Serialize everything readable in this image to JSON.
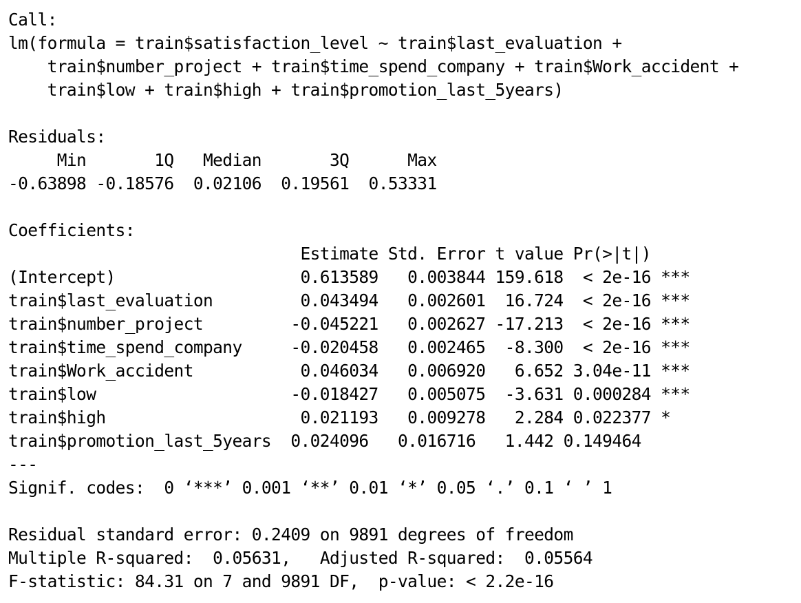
{
  "lines": [
    "Call:",
    "lm(formula = train$satisfaction_level ~ train$last_evaluation +",
    "    train$number_project + train$time_spend_company + train$Work_accident +",
    "    train$low + train$high + train$promotion_last_5years)",
    "",
    "Residuals:",
    "     Min       1Q   Median       3Q      Max",
    "-0.63898 -0.18576  0.02106  0.19561  0.53331",
    "",
    "Coefficients:",
    "                              Estimate Std. Error t value Pr(>|t|)",
    "(Intercept)                   0.613589   0.003844 159.618  < 2e-16 ***",
    "train$last_evaluation         0.043494   0.002601  16.724  < 2e-16 ***",
    "train$number_project         -0.045221   0.002627 -17.213  < 2e-16 ***",
    "train$time_spend_company     -0.020458   0.002465  -8.300  < 2e-16 ***",
    "train$Work_accident           0.046034   0.006920   6.652 3.04e-11 ***",
    "train$low                    -0.018427   0.005075  -3.631 0.000284 ***",
    "train$high                    0.021193   0.009278   2.284 0.022377 *",
    "train$promotion_last_5years  0.024096   0.016716   1.442 0.149464",
    "---",
    "Signif. codes:  0 ‘***’ 0.001 ‘**’ 0.01 ‘*’ 0.05 ‘.’ 0.1 ‘ ’ 1",
    "",
    "Residual standard error: 0.2409 on 9891 degrees of freedom",
    "Multiple R-squared:  0.05631,\tAdjusted R-squared:  0.05564",
    "F-statistic: 84.31 on 7 and 9891 DF,  p-value: < 2.2e-16"
  ]
}
